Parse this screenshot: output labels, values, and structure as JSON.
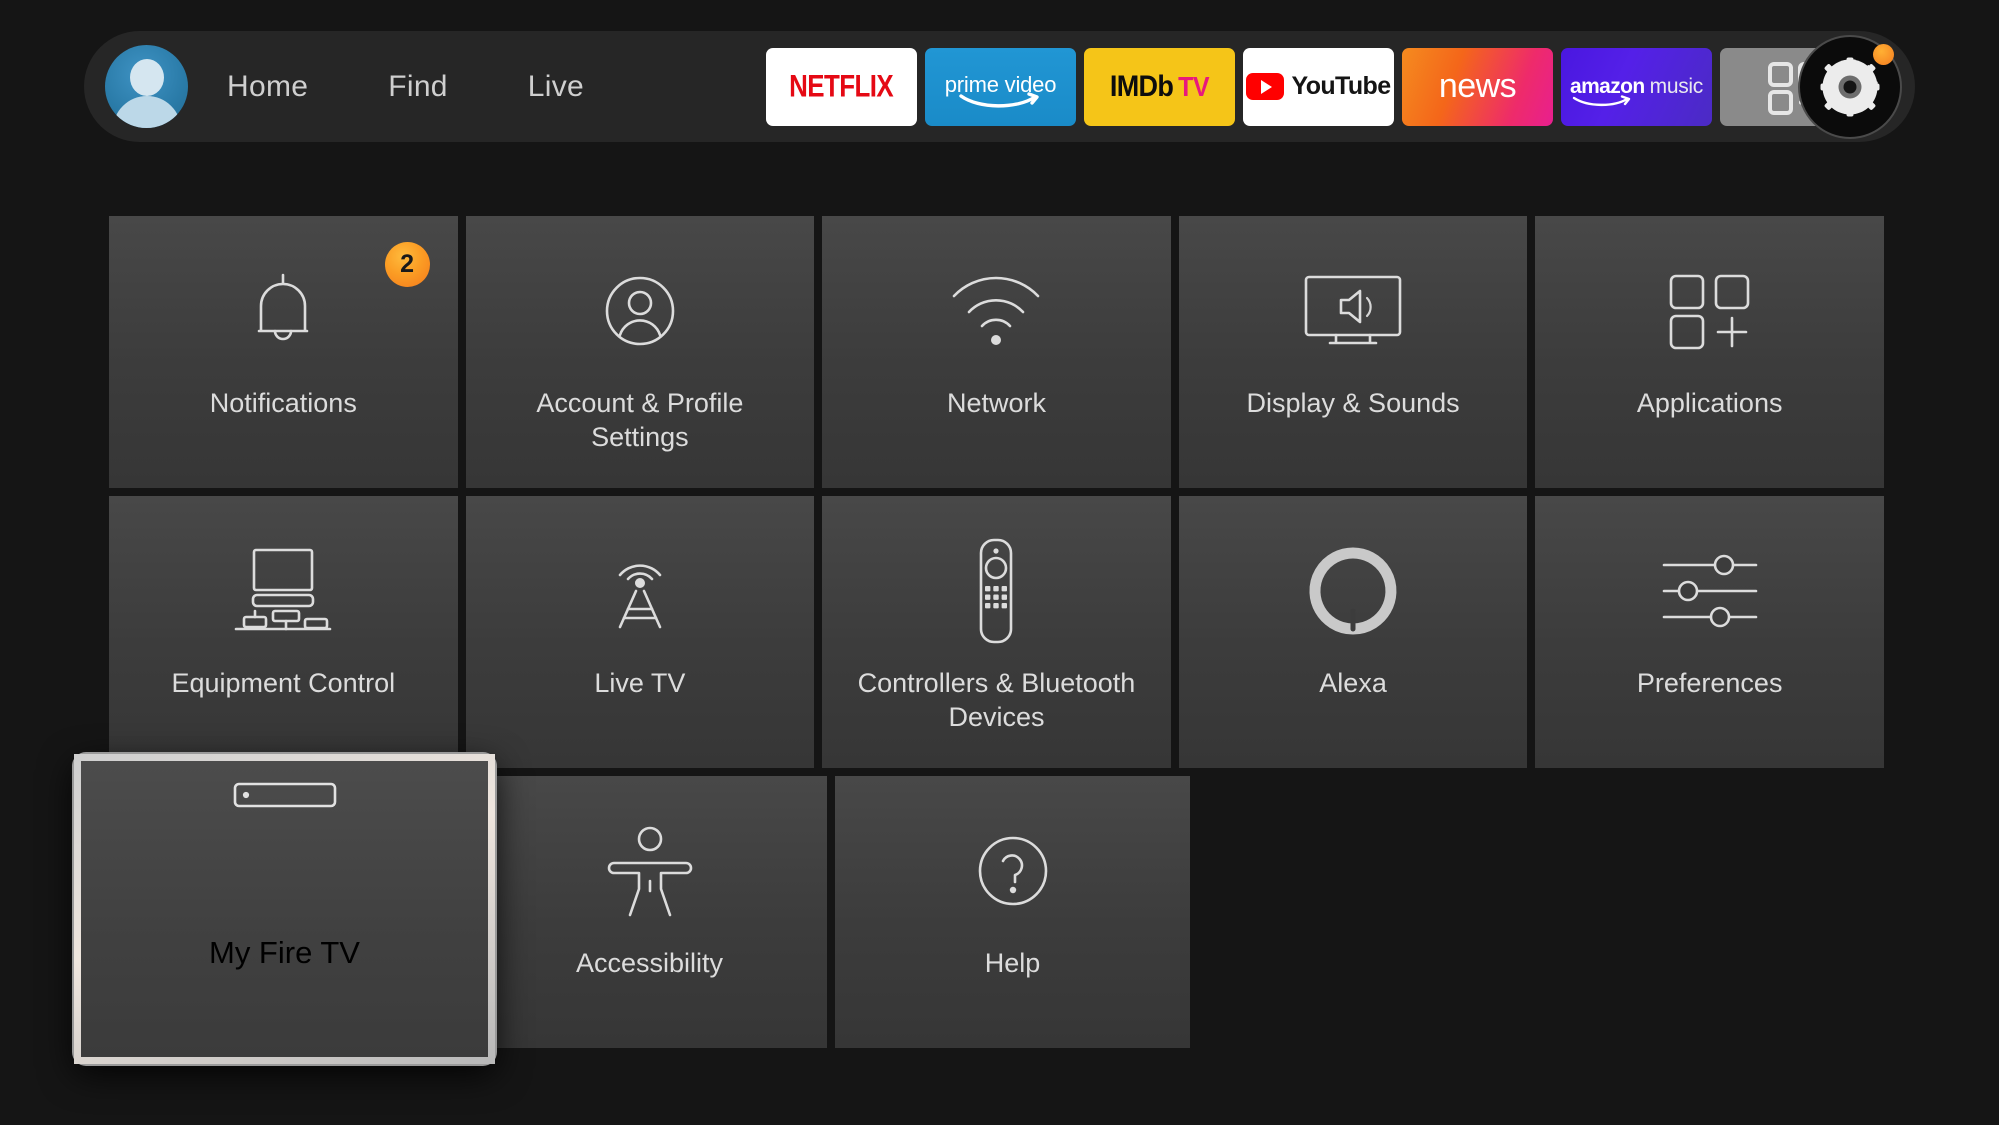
{
  "nav": {
    "avatar_name": "profile-avatar",
    "links": [
      {
        "label": "Home"
      },
      {
        "label": "Find"
      },
      {
        "label": "Live"
      }
    ],
    "apps": [
      {
        "name": "netflix",
        "label": "NETFLIX"
      },
      {
        "name": "prime-video",
        "label": "prime video"
      },
      {
        "name": "imdb-tv",
        "label": "IMDb",
        "label2": "TV"
      },
      {
        "name": "youtube",
        "label": "YouTube"
      },
      {
        "name": "news",
        "label": "news"
      },
      {
        "name": "amazon-music",
        "label": "amazon",
        "label2": "music"
      },
      {
        "name": "app-library",
        "label": ""
      }
    ],
    "settings_button": {
      "icon": "gear-icon",
      "has_notification_dot": true,
      "dot_color": "#f4791c"
    }
  },
  "grid": {
    "rows": [
      [
        {
          "label": "Notifications",
          "icon": "bell-icon",
          "badge": "2"
        },
        {
          "label": "Account & Profile Settings",
          "icon": "person-circle-icon"
        },
        {
          "label": "Network",
          "icon": "wifi-icon"
        },
        {
          "label": "Display & Sounds",
          "icon": "tv-speaker-icon"
        },
        {
          "label": "Applications",
          "icon": "app-grid-plus-icon"
        }
      ],
      [
        {
          "label": "Equipment Control",
          "icon": "tv-equipment-icon"
        },
        {
          "label": "Live TV",
          "icon": "antenna-icon"
        },
        {
          "label": "Controllers & Bluetooth Devices",
          "icon": "remote-icon"
        },
        {
          "label": "Alexa",
          "icon": "alexa-ring-icon"
        },
        {
          "label": "Preferences",
          "icon": "sliders-icon"
        }
      ],
      [
        {
          "label": "My Fire TV",
          "icon": "fire-tv-stick-icon",
          "focused": true
        },
        {
          "label": "Accessibility",
          "icon": "accessibility-person-icon"
        },
        {
          "label": "Help",
          "icon": "question-circle-icon"
        }
      ]
    ]
  },
  "colors": {
    "background": "#151515",
    "navbar": "#262626",
    "tile": "#3f3f3f",
    "label": "#dcdcdc",
    "accent_orange": "#f4791c",
    "focus_border": "#dddddd"
  }
}
